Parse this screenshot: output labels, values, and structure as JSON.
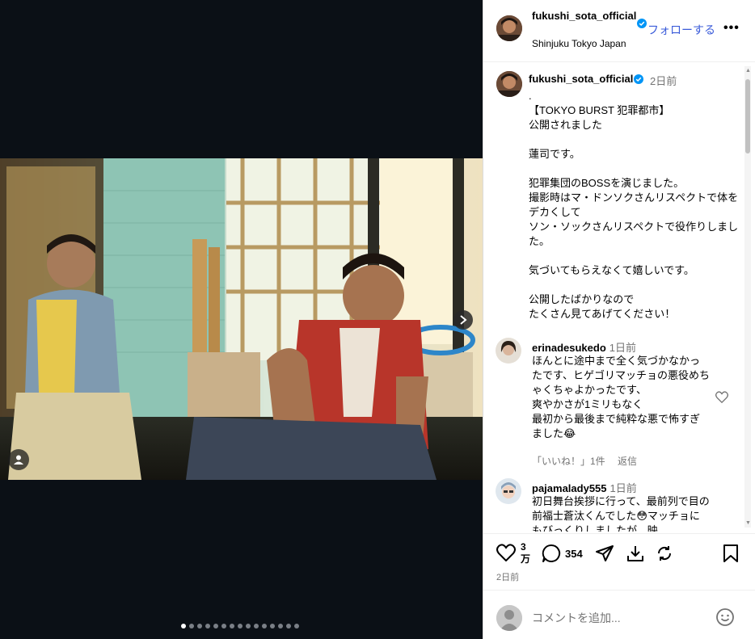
{
  "header": {
    "username": "fukushi_sota_official",
    "follow_label": "フォローする",
    "location": "Shinjuku Tokyo Japan",
    "more_label": "•••"
  },
  "caption": {
    "username": "fukushi_sota_official",
    "time": "2日前",
    "text": ".\n【TOKYO BURST 犯罪都市】\n公開されました\n\n蓮司です。\n\n犯罪集団のBOSSを演じました。\n撮影時はマ・ドンソクさんリスペクトで体をデカくして\nソン・ソックさんリスペクトで役作りしました。\n\n気づいてもらえなくて嬉しいです。\n\n公開したばかりなので\nたくさん見てあげてください！"
  },
  "comments": [
    {
      "username": "erinadesukedo",
      "time": "1日前",
      "text": "ほんとに途中まで全く気づかなかったです、ヒゲゴリマッチョの悪役めちゃくちゃよかったです、\n爽やかさが1ミリもなく\n最初から最後まで純粋な悪で怖すぎました😂",
      "likes_label": "「いいね！」1件",
      "reply_label": "返信"
    },
    {
      "username": "pajamalady555",
      "time": "1日前",
      "text": "初日舞台挨拶に行って、最前列で目の前福士蒼汰くんでした😳マッチョにもびっくりしましたが、映"
    }
  ],
  "actions": {
    "likes": "3万",
    "comment_count": "354",
    "post_time": "2日前"
  },
  "add_comment": {
    "placeholder": "コメントを追加..."
  },
  "carousel": {
    "total_slides": 15,
    "active_index": 0
  },
  "colors": {
    "follow": "#3a5bd9",
    "verified": "#0095f6",
    "media_bg": "#0b1016"
  },
  "icons": {
    "like": "heart-icon",
    "comment": "comment-icon",
    "share": "send-icon",
    "download": "download-icon",
    "repost": "repost-icon",
    "save": "bookmark-icon",
    "emoji": "emoji-icon",
    "next": "chevron-right-icon",
    "tag": "user-tag-icon",
    "verified": "verified-badge-icon"
  }
}
